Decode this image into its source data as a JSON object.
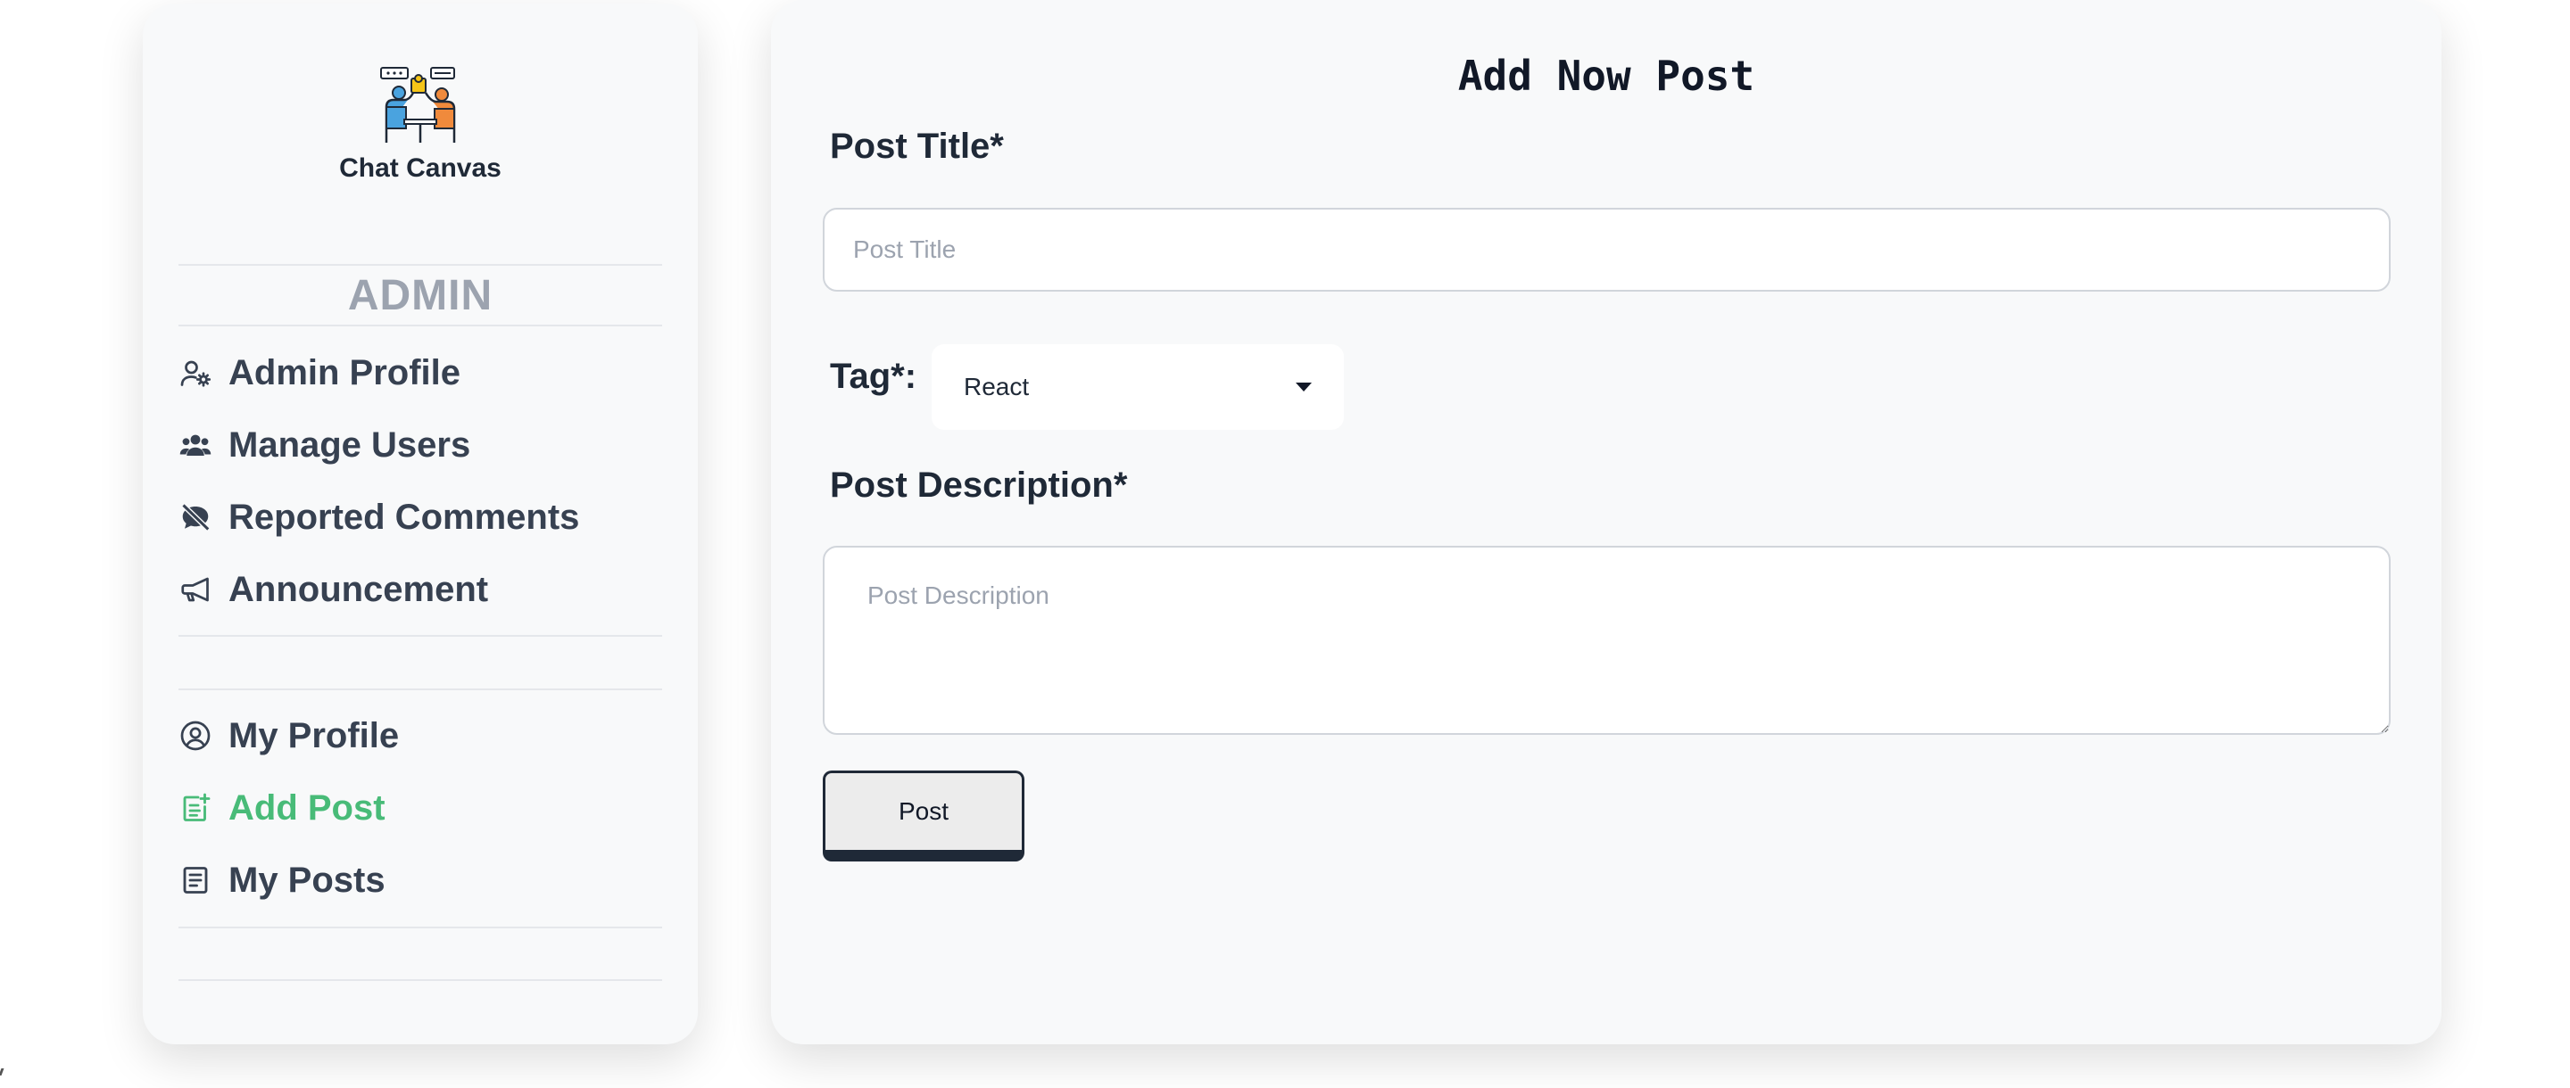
{
  "sidebar": {
    "brand": "Chat Canvas",
    "logo_icon": "team-collaboration-logo",
    "role_heading": "ADMIN",
    "admin_items": [
      {
        "label": "Admin Profile",
        "icon": "user-gear-icon"
      },
      {
        "label": "Manage Users",
        "icon": "users-icon"
      },
      {
        "label": "Reported Comments",
        "icon": "comment-slash-icon"
      },
      {
        "label": "Announcement",
        "icon": "megaphone-icon"
      }
    ],
    "user_items": [
      {
        "label": "My Profile",
        "icon": "user-circle-icon"
      },
      {
        "label": "Add Post",
        "icon": "add-post-icon",
        "active": true
      },
      {
        "label": "My Posts",
        "icon": "document-list-icon"
      }
    ]
  },
  "main": {
    "title": "Add Now Post",
    "post_title_label": "Post Title*",
    "post_title_placeholder": "Post Title",
    "post_title_value": "",
    "tag_label": "Tag*:",
    "tag_selected": "React",
    "description_label": "Post Description*",
    "description_placeholder": "Post Description",
    "description_value": "",
    "submit_label": "Post"
  },
  "colors": {
    "active_accent": "#48bb78",
    "panel_bg": "#f8f9fa",
    "role_heading": "#9ca3af",
    "nav_text": "#374151"
  }
}
